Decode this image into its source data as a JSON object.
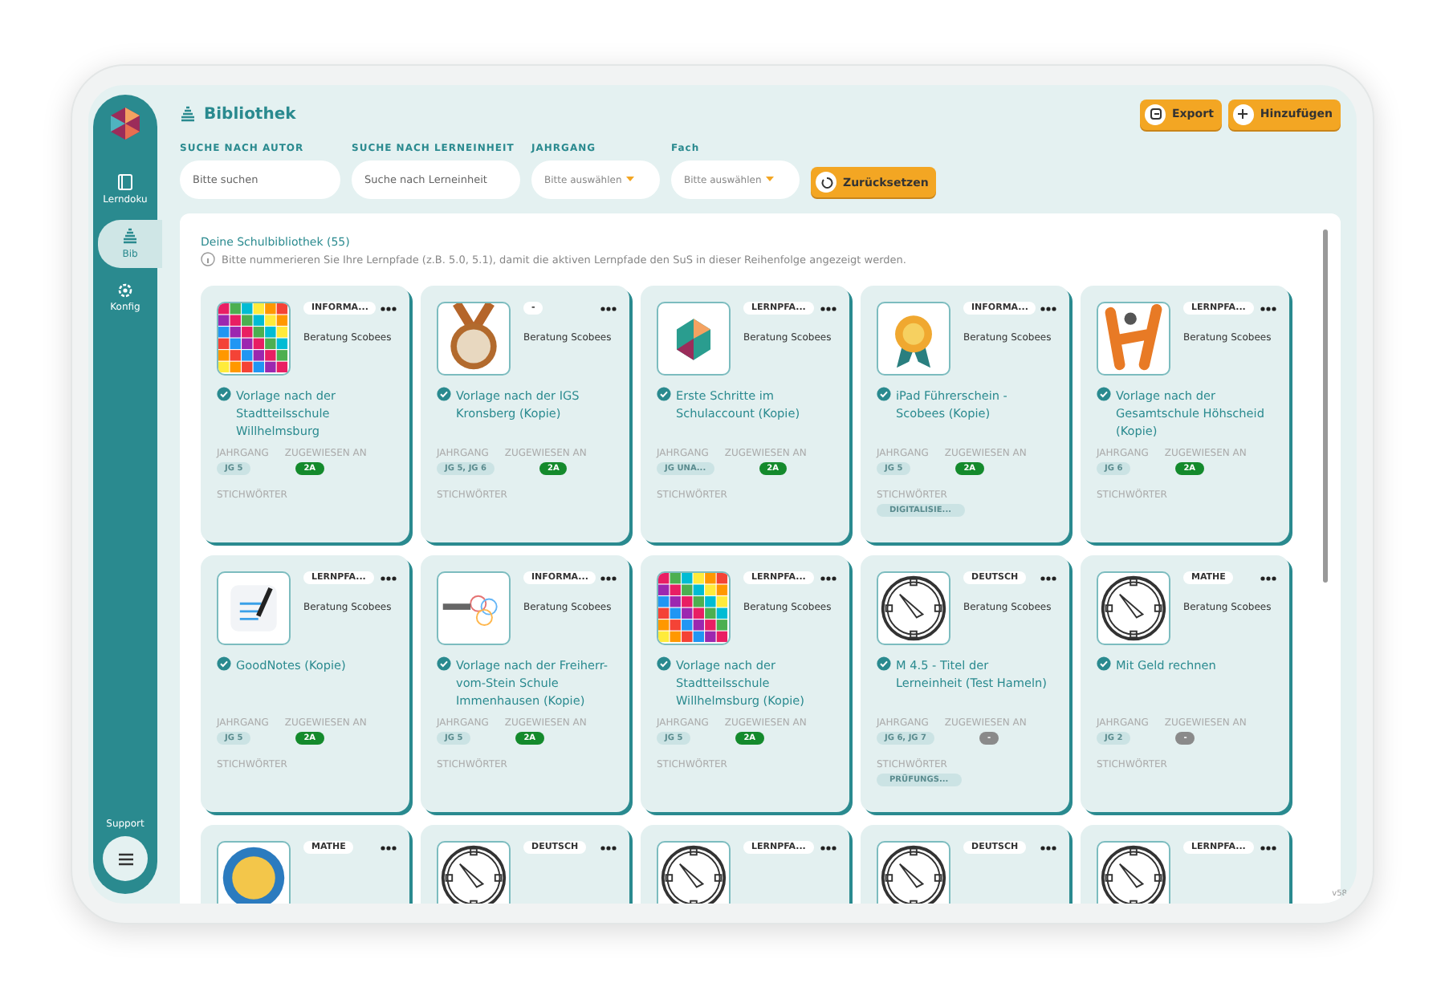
{
  "sidebar": {
    "items": [
      {
        "label": "Lerndoku",
        "selected": false
      },
      {
        "label": "Bib",
        "selected": true
      },
      {
        "label": "Konfig",
        "selected": false
      }
    ],
    "support": "Support"
  },
  "header": {
    "title": "Bibliothek",
    "buttons": [
      {
        "label": "Export"
      },
      {
        "label": "Hinzufügen"
      }
    ]
  },
  "filters": [
    {
      "label": "SUCHE NACH AUTOR",
      "kind": "text",
      "placeholder": "Bitte suchen"
    },
    {
      "label": "SUCHE NACH LERNEINHEIT",
      "kind": "text",
      "placeholder": "Suche nach Lerneinheit"
    },
    {
      "label": "JAHRGANG",
      "kind": "select",
      "placeholder": "Bitte auswählen"
    },
    {
      "label": "Fach",
      "kind": "select",
      "placeholder": "Bitte auswählen"
    }
  ],
  "reset_button": "Zurücksetzen",
  "library": {
    "title": "Deine Schulbibliothek (55)",
    "info": "Bitte nummerieren Sie Ihre Lernpfade (z.B. 5.0, 5.1), damit die aktiven Lernpfade den SuS in dieser Reihenfolge angezeigt werden."
  },
  "cards": [
    {
      "kind": "mosaic",
      "subject": "INFORMA...",
      "author": "Beratung Scobees",
      "title": "Vorlage nach der Stadtteilsschule Willhelmsburg",
      "grade_label": "JAHRGANG",
      "assigned_label": "ZUGEWIESEN AN",
      "keywords_label": "STICHWÖRTER",
      "grades": "JG 5",
      "assigned": {
        "text": "2A",
        "kind": "class"
      }
    },
    {
      "kind": "medal",
      "subject": "-",
      "author": "Beratung Scobees",
      "title": "Vorlage nach der IGS Kronsberg (Kopie)",
      "grade_label": "JAHRGANG",
      "assigned_label": "ZUGEWIESEN AN",
      "keywords_label": "STICHWÖRTER",
      "grades": "JG 5, JG 6",
      "assigned": {
        "text": "2A",
        "kind": "class"
      }
    },
    {
      "kind": "hexagon",
      "subject": "LERNPFA...",
      "author": "Beratung Scobees",
      "title": "Erste Schritte im Schulaccount (Kopie)",
      "grade_label": "JAHRGANG",
      "assigned_label": "ZUGEWIESEN AN",
      "keywords_label": "STICHWÖRTER",
      "grades": "JG UNA...",
      "assigned": {
        "text": "2A",
        "kind": "class"
      }
    },
    {
      "kind": "rosette",
      "subject": "INFORMA...",
      "author": "Beratung Scobees",
      "title": "iPad Führerschein - Scobees (Kopie)",
      "grade_label": "JAHRGANG",
      "assigned_label": "ZUGEWIESEN AN",
      "keywords_label": "STICHWÖRTER",
      "grades": "JG 5",
      "assigned": {
        "text": "2A",
        "kind": "class"
      },
      "keyword": "DIGITALISIE..."
    },
    {
      "kind": "figure",
      "subject": "LERNPFA...",
      "author": "Beratung Scobees",
      "title": "Vorlage nach der Gesamtschule Höhscheid (Kopie)",
      "grade_label": "JAHRGANG",
      "assigned_label": "ZUGEWIESEN AN",
      "keywords_label": "STICHWÖRTER",
      "grades": "JG 6",
      "assigned": {
        "text": "2A",
        "kind": "class"
      }
    },
    {
      "kind": "notes",
      "subject": "LERNPFA...",
      "author": "Beratung Scobees",
      "title": "GoodNotes (Kopie)",
      "grade_label": "JAHRGANG",
      "assigned_label": "ZUGEWIESEN AN",
      "keywords_label": "STICHWÖRTER",
      "grades": "JG 5",
      "assigned": {
        "text": "2A",
        "kind": "class"
      }
    },
    {
      "kind": "rings",
      "subject": "INFORMA...",
      "author": "Beratung Scobees",
      "title": "Vorlage nach der Freiherr-vom-Stein Schule Immenhausen (Kopie)",
      "grade_label": "JAHRGANG",
      "assigned_label": "ZUGEWIESEN AN",
      "keywords_label": "STICHWÖRTER",
      "grades": "JG 5",
      "assigned": {
        "text": "2A",
        "kind": "class"
      }
    },
    {
      "kind": "mosaic",
      "subject": "LERNPFA...",
      "author": "Beratung Scobees",
      "title": "Vorlage nach der Stadtteilsschule Willhelmsburg (Kopie)",
      "grade_label": "JAHRGANG",
      "assigned_label": "ZUGEWIESEN AN",
      "keywords_label": "STICHWÖRTER",
      "grades": "JG 5",
      "assigned": {
        "text": "2A",
        "kind": "class"
      }
    },
    {
      "kind": "compass",
      "subject": "DEUTSCH",
      "author": "Beratung Scobees",
      "title": "M 4.5 - Titel der Lerneinheit (Test Hameln)",
      "grade_label": "JAHRGANG",
      "assigned_label": "ZUGEWIESEN AN",
      "keywords_label": "STICHWÖRTER",
      "grades": "JG 6, JG 7",
      "assigned": {
        "text": "-",
        "kind": "none"
      },
      "keyword": "PRÜFUNGS..."
    },
    {
      "kind": "compass",
      "subject": "MATHE",
      "author": "Beratung Scobees",
      "title": "Mit Geld rechnen",
      "grade_label": "JAHRGANG",
      "assigned_label": "ZUGEWIESEN AN",
      "keywords_label": "STICHWÖRTER",
      "grades": "JG 2",
      "assigned": {
        "text": "-",
        "kind": "none"
      }
    },
    {
      "kind": "globe",
      "subject": "MATHE"
    },
    {
      "kind": "compass",
      "subject": "DEUTSCH"
    },
    {
      "kind": "compass",
      "subject": "LERNPFA..."
    },
    {
      "kind": "compass",
      "subject": "DEUTSCH"
    },
    {
      "kind": "compass",
      "subject": "LERNPFA..."
    }
  ],
  "version": "v58"
}
